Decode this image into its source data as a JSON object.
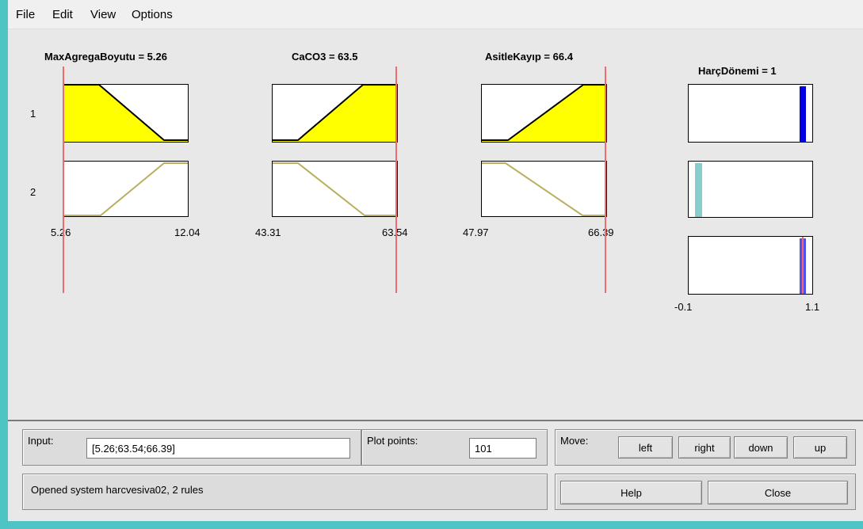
{
  "menu": {
    "file": "File",
    "edit": "Edit",
    "view": "View",
    "options": "Options"
  },
  "inputs": [
    {
      "title": "MaxAgregaBoyutu = 5.26",
      "min_label": "5.26",
      "max_label": "12.04"
    },
    {
      "title": "CaCO3 = 63.5",
      "min_label": "43.31",
      "max_label": "63.54"
    },
    {
      "title": "AsitleKayıp = 66.4",
      "min_label": "47.97",
      "max_label": "66.39"
    }
  ],
  "rule_numbers": [
    "1",
    "2"
  ],
  "output": {
    "title": "HarçDönemi = 1",
    "min_label": "-0.1",
    "max_label": "1.1"
  },
  "colors": {
    "mf_fill": "#ffff00",
    "mf_line": "#b8b060",
    "cursor": "#f06b6b",
    "out_rule1": "#0000e0",
    "out_rule2": "#88cccc",
    "out_aggregate": "#5050f0"
  },
  "input_panel": {
    "label": "Input:",
    "value": "[5.26;63.54;66.39]"
  },
  "plot_points_panel": {
    "label": "Plot points:",
    "value": "101"
  },
  "move_panel": {
    "label": "Move:",
    "left": "left",
    "right": "right",
    "down": "down",
    "up": "up"
  },
  "status": "Opened system harcvesiva02, 2 rules",
  "buttons": {
    "help": "Help",
    "close": "Close"
  }
}
